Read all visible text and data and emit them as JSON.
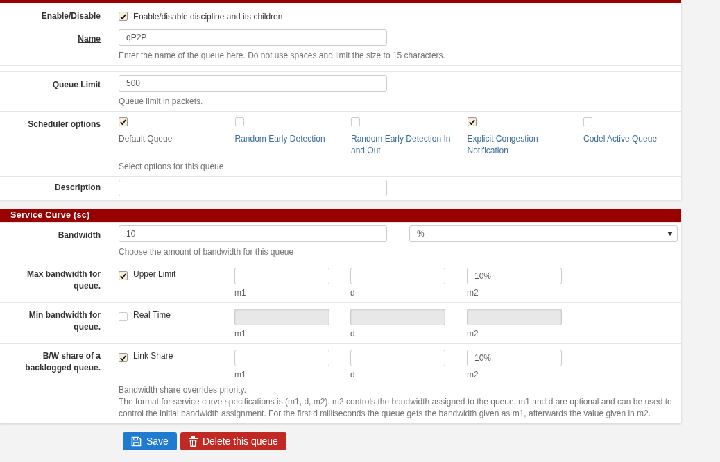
{
  "general": {
    "enable": {
      "label": "Enable/Disable",
      "checked": true,
      "text": "Enable/disable discipline and its children"
    },
    "name": {
      "label": "Name",
      "underlined": true,
      "value": "qP2P",
      "help": "Enter the name of the queue here. Do not use spaces and limit the size to 15 characters."
    },
    "queue_limit": {
      "label": "Queue Limit",
      "value": "500",
      "help": "Queue limit in packets."
    },
    "scheduler": {
      "label": "Scheduler options",
      "help": "Select options for this queue",
      "options": [
        {
          "label": "Default Queue",
          "checked": true,
          "link": false
        },
        {
          "label": "Random Early Detection",
          "checked": false,
          "link": true
        },
        {
          "label": "Random Early Detection In and Out",
          "checked": false,
          "link": true
        },
        {
          "label": "Explicit Congestion Notification",
          "checked": true,
          "link": true
        },
        {
          "label": "Codel Active Queue",
          "checked": false,
          "link": true
        }
      ]
    },
    "description": {
      "label": "Description"
    }
  },
  "service_curve": {
    "title": "Service Curve (sc)",
    "bandwidth": {
      "label": "Bandwidth",
      "value": "10",
      "unit": "%",
      "help": "Choose the amount of bandwidth for this queue"
    },
    "curves": [
      {
        "label": "Max bandwidth for queue.",
        "checked": true,
        "text": "Upper Limit",
        "disabled": false,
        "fields": [
          {
            "caption": "m1"
          },
          {
            "caption": "d"
          },
          {
            "caption": "m2",
            "value": "10%"
          }
        ]
      },
      {
        "label": "Min bandwidth for queue.",
        "checked": false,
        "text": "Real Time",
        "disabled": true,
        "fields": [
          {
            "caption": "m1"
          },
          {
            "caption": "d"
          },
          {
            "caption": "m2"
          }
        ]
      },
      {
        "label": "B/W share of a backlogged queue.",
        "checked": true,
        "text": "Link Share",
        "disabled": false,
        "fields": [
          {
            "caption": "m1"
          },
          {
            "caption": "d"
          },
          {
            "caption": "m2",
            "value": "10%"
          }
        ]
      }
    ],
    "help": [
      "Bandwidth share overrides priority.",
      "The format for service curve specifications is (m1, d, m2). m2 controls the bandwidth assigned to the queue. m1 and d are optional and can be used to control the initial bandwidth assignment. For the first d milliseconds the queue gets the bandwidth given as m1, afterwards the value given in m2."
    ]
  },
  "buttons": [
    {
      "kind": "save",
      "label": "Save"
    },
    {
      "kind": "delete",
      "label": "Delete this queue"
    }
  ]
}
